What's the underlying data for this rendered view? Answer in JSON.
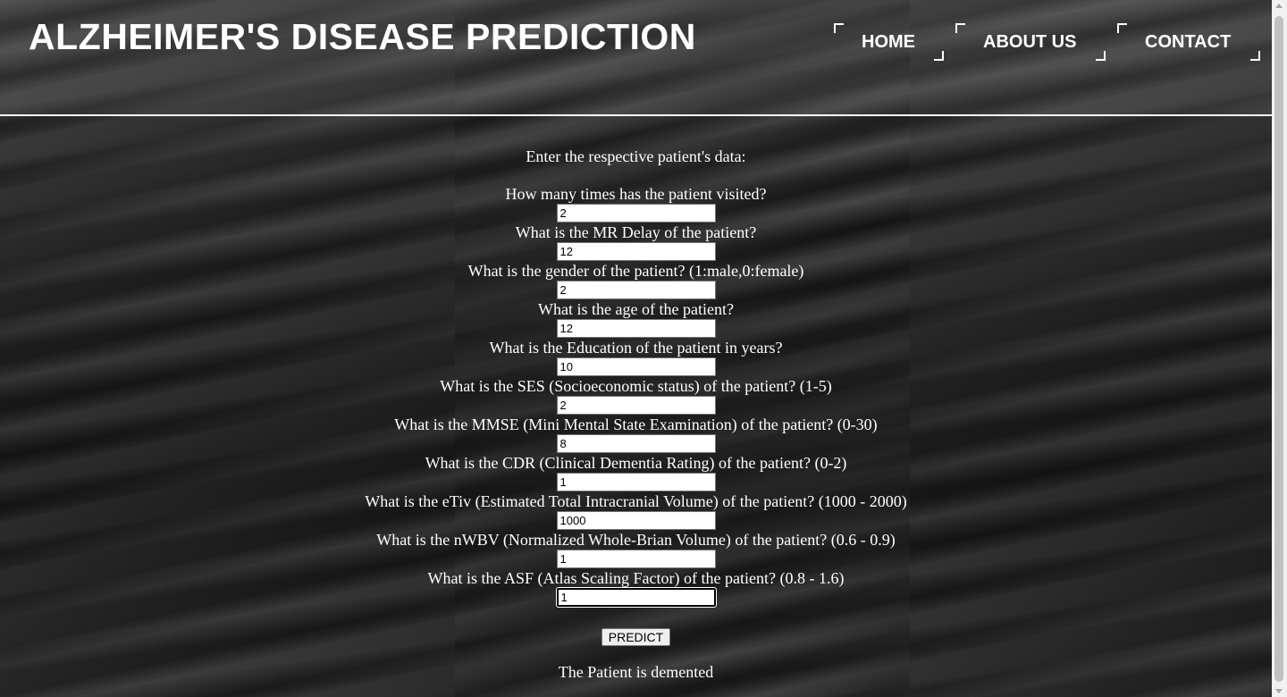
{
  "header": {
    "title": "ALZHEIMER'S DISEASE PREDICTION",
    "nav": {
      "home": "HOME",
      "about": "ABOUT US",
      "contact": "CONTACT"
    }
  },
  "form": {
    "intro": "Enter the respective patient's data:",
    "questions": [
      {
        "label": "How many times has the patient visited?",
        "value": "2"
      },
      {
        "label": "What is the MR Delay of the patient?",
        "value": "12"
      },
      {
        "label": "What is the gender of the patient? (1:male,0:female)",
        "value": "2"
      },
      {
        "label": "What is the age of the patient?",
        "value": "12"
      },
      {
        "label": "What is the Education of the patient in years?",
        "value": "10"
      },
      {
        "label": "What is the SES (Socioeconomic status) of the patient? (1-5)",
        "value": "2"
      },
      {
        "label": "What is the MMSE (Mini Mental State Examination) of the patient? (0-30)",
        "value": "8"
      },
      {
        "label": "What is the CDR (Clinical Dementia Rating) of the patient? (0-2)",
        "value": "1"
      },
      {
        "label": "What is the eTiv (Estimated Total Intracranial Volume) of the patient? (1000 - 2000)",
        "value": "1000"
      },
      {
        "label": "What is the nWBV (Normalized Whole-Brian Volume) of the patient? (0.6 - 0.9)",
        "value": "1"
      },
      {
        "label": "What is the ASF (Atlas Scaling Factor) of the patient? (0.8 - 1.6)",
        "value": "1"
      }
    ],
    "submit_label": "PREDICT",
    "result": "The Patient is demented"
  }
}
